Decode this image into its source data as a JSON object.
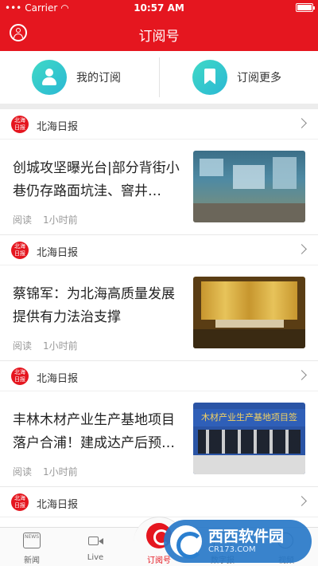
{
  "status_bar": {
    "carrier": "Carrier",
    "time": "10:57 AM"
  },
  "header": {
    "title": "订阅号"
  },
  "subscription_panel": {
    "mine_label": "我的订阅",
    "more_label": "订阅更多"
  },
  "source_logo_text": "北海日报",
  "feed": [
    {
      "source": "北海日报",
      "headline": "创城攻坚曝光台|部分背街小巷仍存路面坑洼、窨井…",
      "read_label": "阅读",
      "time": "1小时前"
    },
    {
      "source": "北海日报",
      "headline": "蔡锦军：为北海高质量发展提供有力法治支撑",
      "read_label": "阅读",
      "time": "1小时前"
    },
    {
      "source": "北海日报",
      "headline": "丰林木材产业生产基地项目落户合浦！建成达产后预…",
      "read_label": "阅读",
      "time": "1小时前"
    },
    {
      "source": "北海日报"
    }
  ],
  "thumb_texts": {
    "banner": "木材产业生产基地项目签"
  },
  "tab_bar": {
    "tabs": [
      {
        "label": "新闻"
      },
      {
        "label": "Live"
      },
      {
        "label": "订阅号"
      },
      {
        "label": "数字报"
      },
      {
        "label": "视频"
      }
    ],
    "news_icon_text": "NEWS"
  },
  "watermark": {
    "main": "西西软件园",
    "sub": "CR173.COM"
  },
  "colors": {
    "brand_red": "#e5161f",
    "teal": "#35c9cd",
    "meta_gray": "#999999"
  }
}
